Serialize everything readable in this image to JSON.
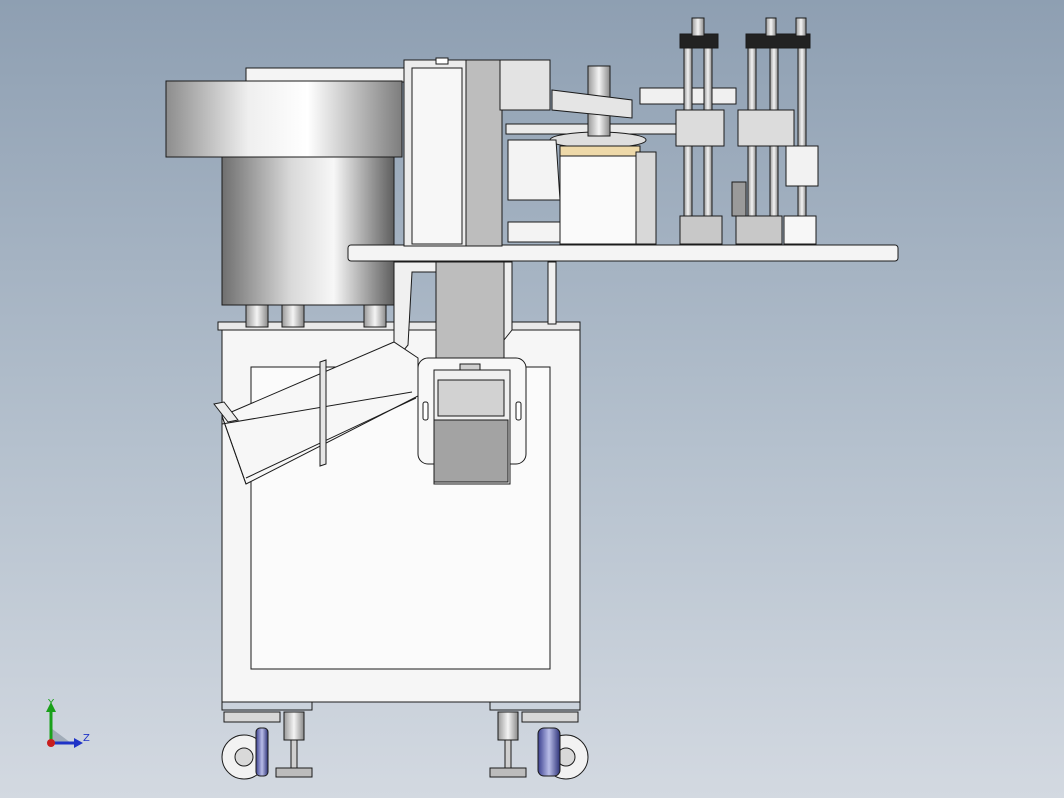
{
  "viewport": {
    "background_top": "#8e9fb2",
    "background_bottom": "#d3d9e1"
  },
  "model": {
    "components": [
      "vibratory-bowl-feeder",
      "linear-feeder-chute",
      "machine-frame-cabinet",
      "top-mounting-plate",
      "rotary-index-table",
      "vertical-press-cylinders",
      "leveling-feet",
      "caster-wheels"
    ],
    "edge_color": "#1b1b1b",
    "body_color": "#f2f2f2"
  },
  "triad": {
    "y_label": "Y",
    "z_label": "Z",
    "y_color": "#1aa01a",
    "z_color": "#1f33c7",
    "origin_color": "#c81e1e"
  }
}
